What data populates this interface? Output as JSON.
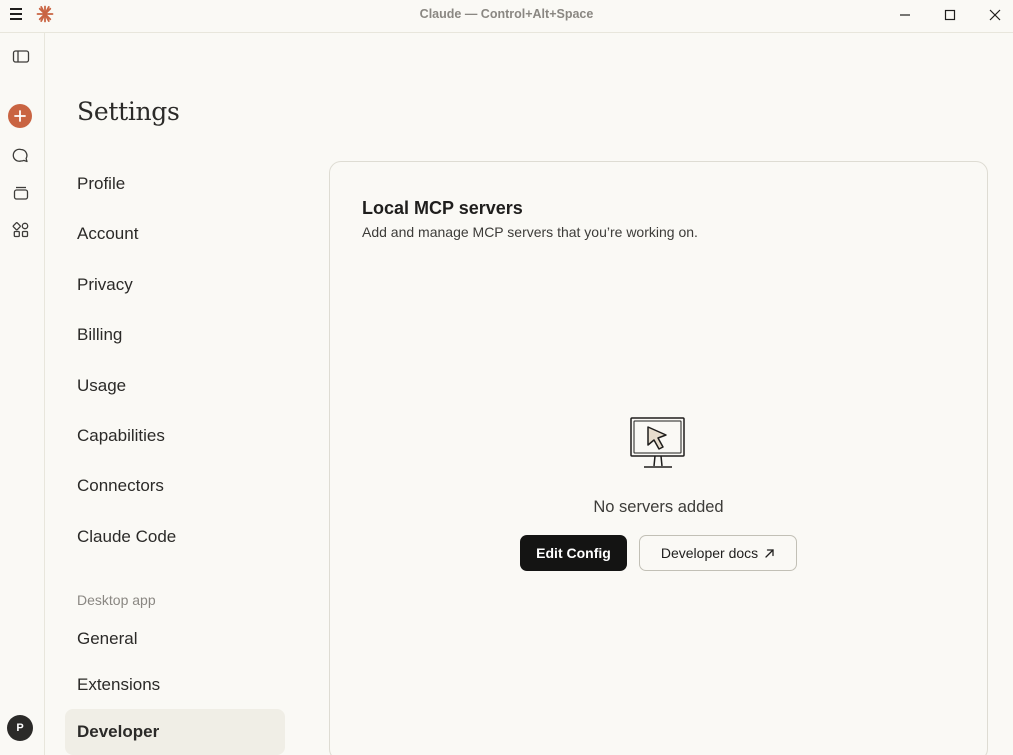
{
  "window": {
    "title": "Claude — Control+Alt+Space"
  },
  "rail": {
    "avatar_initial": "P",
    "icons": [
      "sidebar-toggle-icon",
      "plus-icon",
      "chat-bubble-icon",
      "projects-icon",
      "artifacts-icon"
    ]
  },
  "settings": {
    "title": "Settings",
    "nav": [
      {
        "label": "Profile"
      },
      {
        "label": "Account"
      },
      {
        "label": "Privacy"
      },
      {
        "label": "Billing"
      },
      {
        "label": "Usage"
      },
      {
        "label": "Capabilities"
      },
      {
        "label": "Connectors"
      },
      {
        "label": "Claude Code"
      }
    ],
    "desktop_section_label": "Desktop app",
    "desktop_nav": [
      {
        "label": "General"
      },
      {
        "label": "Extensions"
      },
      {
        "label": "Developer"
      }
    ],
    "active_item": "Developer"
  },
  "main": {
    "title": "Local MCP servers",
    "subtitle": "Add and manage MCP servers that you’re working on.",
    "empty_text": "No servers added",
    "edit_config_label": "Edit Config",
    "developer_docs_label": "Developer docs",
    "accent": "#c96442"
  }
}
